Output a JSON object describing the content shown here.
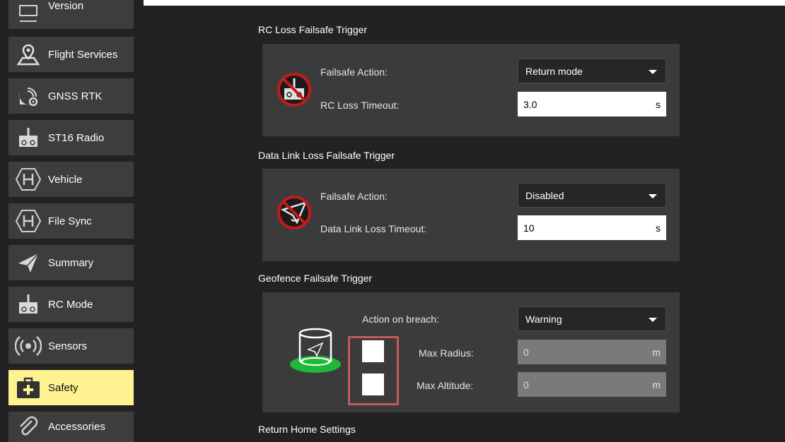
{
  "sidebar": {
    "items": [
      {
        "label": "Version",
        "icon": "monitor-icon"
      },
      {
        "label": "Flight Services",
        "icon": "map-pin-icon"
      },
      {
        "label": "GNSS RTK",
        "icon": "satellite-gear-icon"
      },
      {
        "label": "ST16 Radio",
        "icon": "radio-controller-icon"
      },
      {
        "label": "Vehicle",
        "icon": "hexagon-h-icon"
      },
      {
        "label": "File Sync",
        "icon": "hexagon-h-icon"
      },
      {
        "label": "Summary",
        "icon": "paper-plane-icon"
      },
      {
        "label": "RC Mode",
        "icon": "radio-controller-icon"
      },
      {
        "label": "Sensors",
        "icon": "broadcast-icon"
      },
      {
        "label": "Safety",
        "icon": "first-aid-kit-icon",
        "active": true
      },
      {
        "label": "Accessories",
        "icon": "paperclip-icon"
      }
    ]
  },
  "rc_loss": {
    "title": "RC Loss Failsafe Trigger",
    "action_label": "Failsafe Action:",
    "action_value": "Return mode",
    "timeout_label": "RC Loss Timeout:",
    "timeout_value": "3.0",
    "timeout_unit": "s"
  },
  "datalink_loss": {
    "title": "Data Link Loss Failsafe Trigger",
    "action_label": "Failsafe Action:",
    "action_value": "Disabled",
    "timeout_label": "Data Link Loss Timeout:",
    "timeout_value": "10",
    "timeout_unit": "s"
  },
  "geofence": {
    "title": "Geofence Failsafe Trigger",
    "action_label": "Action on breach:",
    "action_value": "Warning",
    "radius_label": "Max Radius:",
    "radius_value": "0",
    "radius_unit": "m",
    "altitude_label": "Max Altitude:",
    "altitude_value": "0",
    "altitude_unit": "m",
    "radius_enabled": false,
    "altitude_enabled": false
  },
  "return_home": {
    "title": "Return Home Settings"
  },
  "colors": {
    "background": "#222222",
    "nav_item": "#3d3d3d",
    "nav_active": "#fff291",
    "panel": "#3b3b3b",
    "highlight_border": "#c45a5a",
    "geofence_green": "#1fb838"
  }
}
